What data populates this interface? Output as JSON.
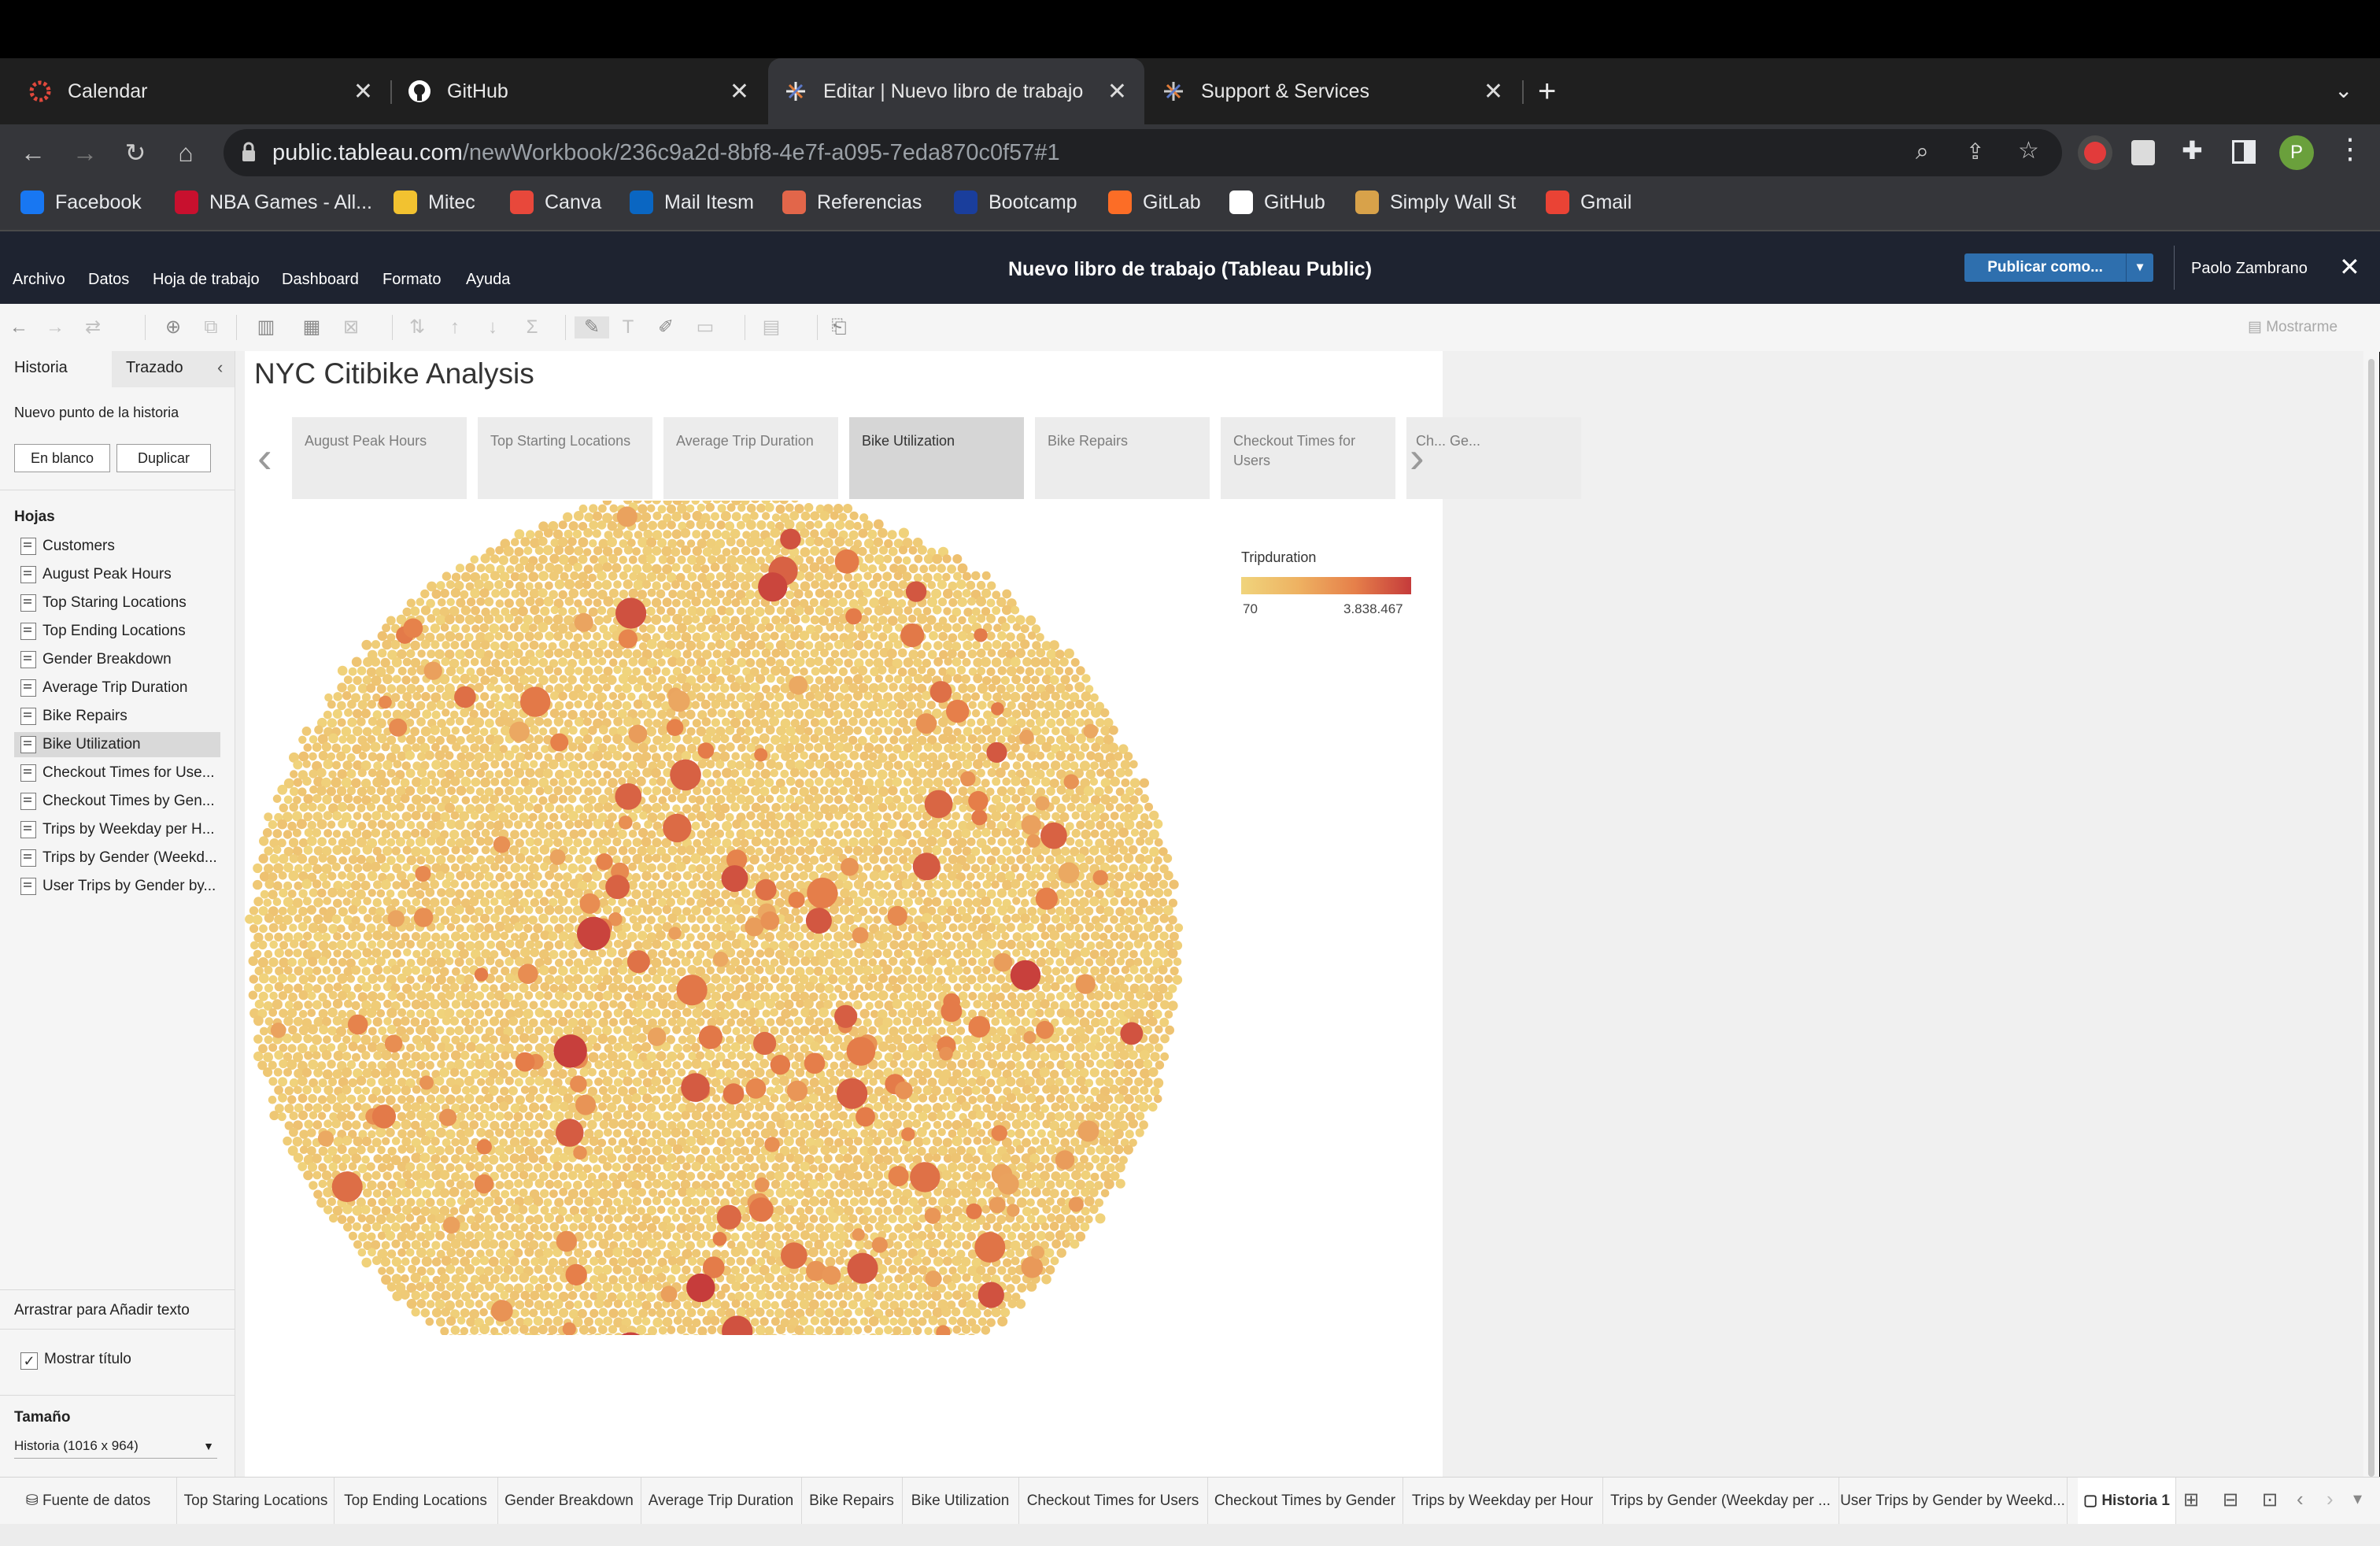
{
  "browser": {
    "tabs": [
      {
        "title": "Calendar",
        "icon": "canvas-icon"
      },
      {
        "title": "GitHub",
        "icon": "github-icon"
      },
      {
        "title": "Editar | Nuevo libro de trabajo",
        "icon": "tableau-icon",
        "active": true
      },
      {
        "title": "Support & Services",
        "icon": "tableau-icon"
      }
    ],
    "url_host": "public.tableau.com",
    "url_path": "/newWorkbook/236c9a2d-8bf8-4e7f-a095-7eda870c0f57#1",
    "profile_initial": "P",
    "bookmarks": [
      {
        "label": "Facebook",
        "color": "#1877f2"
      },
      {
        "label": "NBA Games - All...",
        "color": "#c8102e"
      },
      {
        "label": "Mitec",
        "color": "#f2c230"
      },
      {
        "label": "Canva",
        "color": "#e8483b"
      },
      {
        "label": "Mail Itesm",
        "color": "#0a66c2"
      },
      {
        "label": "Referencias",
        "color": "#e2664a"
      },
      {
        "label": "Bootcamp",
        "color": "#1a3e9c"
      },
      {
        "label": "GitLab",
        "color": "#fc6d26"
      },
      {
        "label": "GitHub",
        "color": "#ffffff"
      },
      {
        "label": "Simply Wall St",
        "color": "#d8a24a"
      },
      {
        "label": "Gmail",
        "color": "#ea4335"
      }
    ]
  },
  "tableau": {
    "menu": [
      "Archivo",
      "Datos",
      "Hoja de trabajo",
      "Dashboard",
      "Formato",
      "Ayuda"
    ],
    "workbook_title": "Nuevo libro de trabajo (Tableau Public)",
    "publish_label": "Publicar como...",
    "user": "Paolo Zambrano",
    "show_me": "Mostrarme"
  },
  "left_panel": {
    "tab_story": "Historia",
    "tab_layout": "Trazado",
    "new_point": "Nuevo punto de la historia",
    "btn_blank": "En blanco",
    "btn_duplicate": "Duplicar",
    "sheets_heading": "Hojas",
    "sheets": [
      "Customers",
      "August Peak Hours",
      "Top Staring Locations",
      "Top Ending Locations",
      "Gender Breakdown",
      "Average Trip Duration",
      "Bike Repairs",
      "Bike Utilization",
      "Checkout Times for Use...",
      "Checkout Times by Gen...",
      "Trips by Weekday per H...",
      "Trips by Gender (Weekd...",
      "User Trips by Gender by..."
    ],
    "selected_sheet": 7,
    "drag_text": "Arrastrar para Añadir texto",
    "show_title": "Mostrar título",
    "size_heading": "Tamaño",
    "size_value": "Historia (1016 x 964)"
  },
  "story": {
    "title": "NYC Citibike Analysis",
    "points": [
      "August Peak Hours",
      "Top Starting Locations",
      "Average Trip Duration",
      "Bike Utilization",
      "Bike Repairs",
      "Checkout Times for Users",
      "Ch... Ge..."
    ],
    "selected_point": 3,
    "legend": {
      "title": "Tripduration",
      "min": "70",
      "max": "3.838.467"
    },
    "colors": {
      "low": "#f0d47c",
      "mid": "#e6804a",
      "high": "#c53b3b"
    }
  },
  "bottom_tabs": {
    "data_source": "Fuente de datos",
    "sheets": [
      "Top Staring Locations",
      "Top Ending Locations",
      "Gender Breakdown",
      "Average Trip Duration",
      "Bike Repairs",
      "Bike Utilization",
      "Checkout Times for Users",
      "Checkout Times by Gender",
      "Trips by Weekday per Hour",
      "Trips by Gender (Weekday per ...",
      "User Trips by Gender by Weekd..."
    ],
    "active": "Historia 1"
  }
}
